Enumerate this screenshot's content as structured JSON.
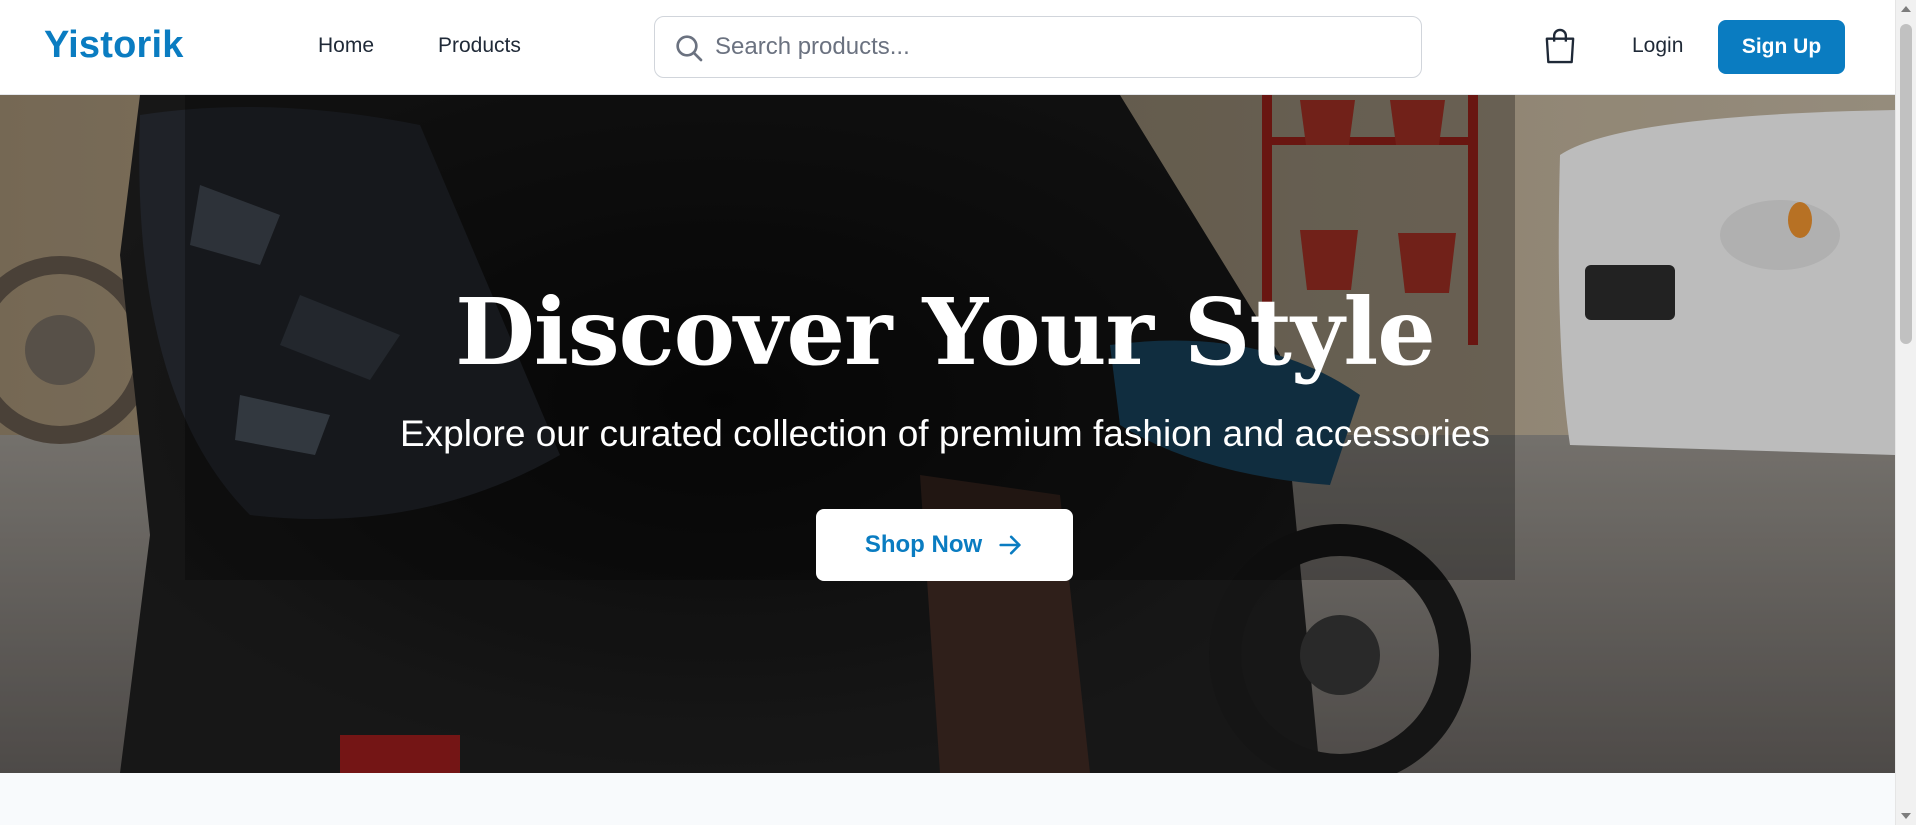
{
  "navbar": {
    "logo": "Yistorik",
    "links": [
      {
        "label": "Home"
      },
      {
        "label": "Products"
      }
    ],
    "search": {
      "placeholder": "Search products...",
      "value": ""
    },
    "cart_icon": "shopping-bag-icon",
    "login_label": "Login",
    "signup_label": "Sign Up"
  },
  "hero": {
    "title": "Discover Your Style",
    "subtitle": "Explore our curated collection of premium fashion and accessories",
    "cta_label": "Shop Now",
    "cta_icon": "arrow-right-icon"
  },
  "colors": {
    "brand": "#0a7cc1",
    "text": "#1f2937",
    "page_background": "#f8fafc"
  }
}
